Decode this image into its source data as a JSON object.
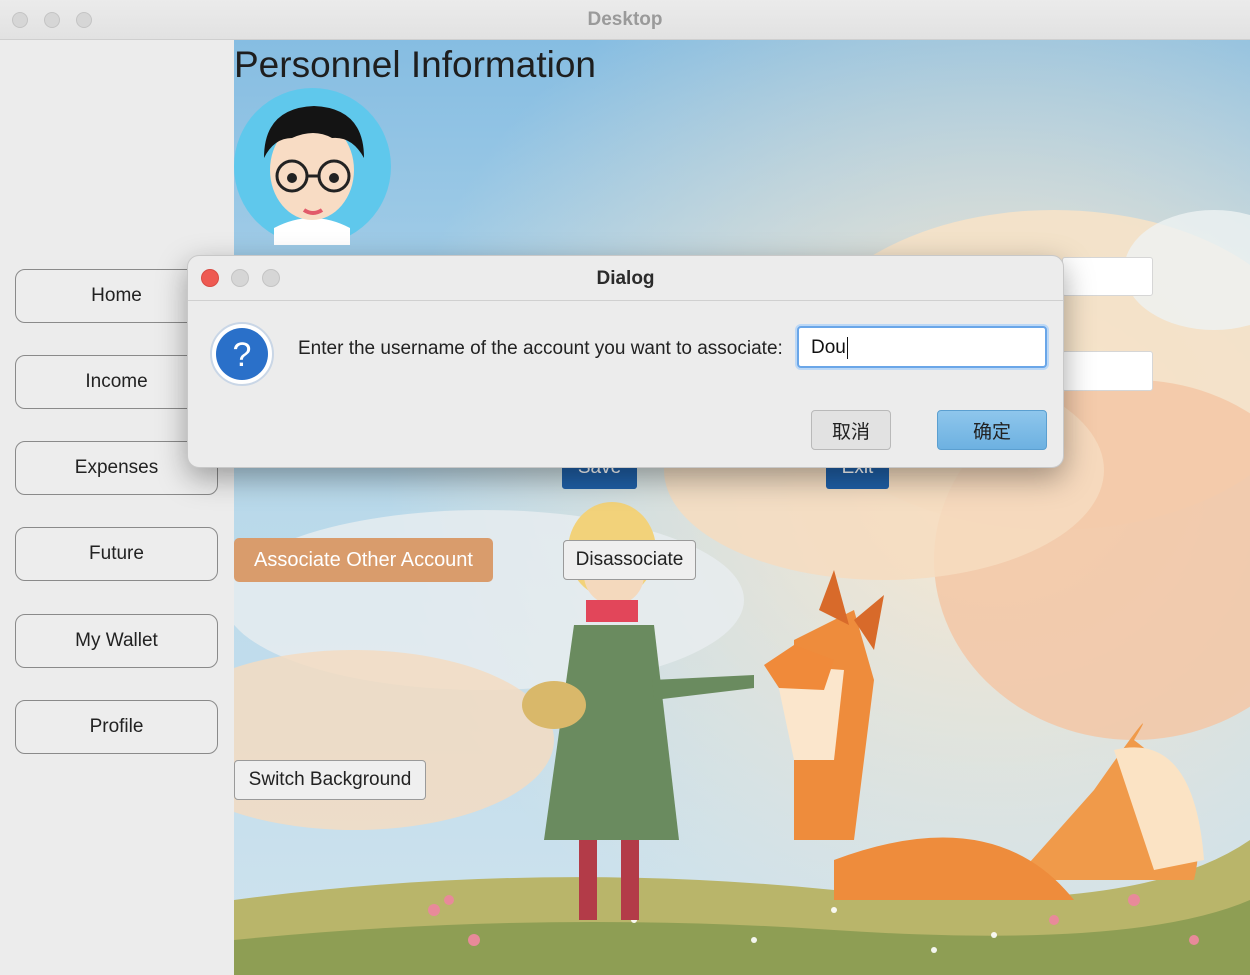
{
  "window": {
    "title": "Desktop"
  },
  "sidebar": {
    "items": [
      {
        "label": "Home"
      },
      {
        "label": "Income"
      },
      {
        "label": "Expenses"
      },
      {
        "label": "Future"
      },
      {
        "label": "My Wallet"
      },
      {
        "label": "Profile"
      }
    ]
  },
  "main": {
    "title": "Personnel Information",
    "save_label": "Save",
    "exit_label": "Exit",
    "associate_label": "Associate Other Account",
    "disassociate_label": "Disassociate",
    "switch_bg_label": "Switch Background"
  },
  "dialog": {
    "title": "Dialog",
    "icon": "question-icon",
    "prompt": "Enter the username of the account you want to associate:",
    "input_value": "Dou",
    "cancel_label": "取消",
    "ok_label": "确定"
  },
  "colors": {
    "accent_blue": "#1f5fa6",
    "associate_orange": "#d99c6c",
    "dialog_ok": "#7bbbe7"
  }
}
